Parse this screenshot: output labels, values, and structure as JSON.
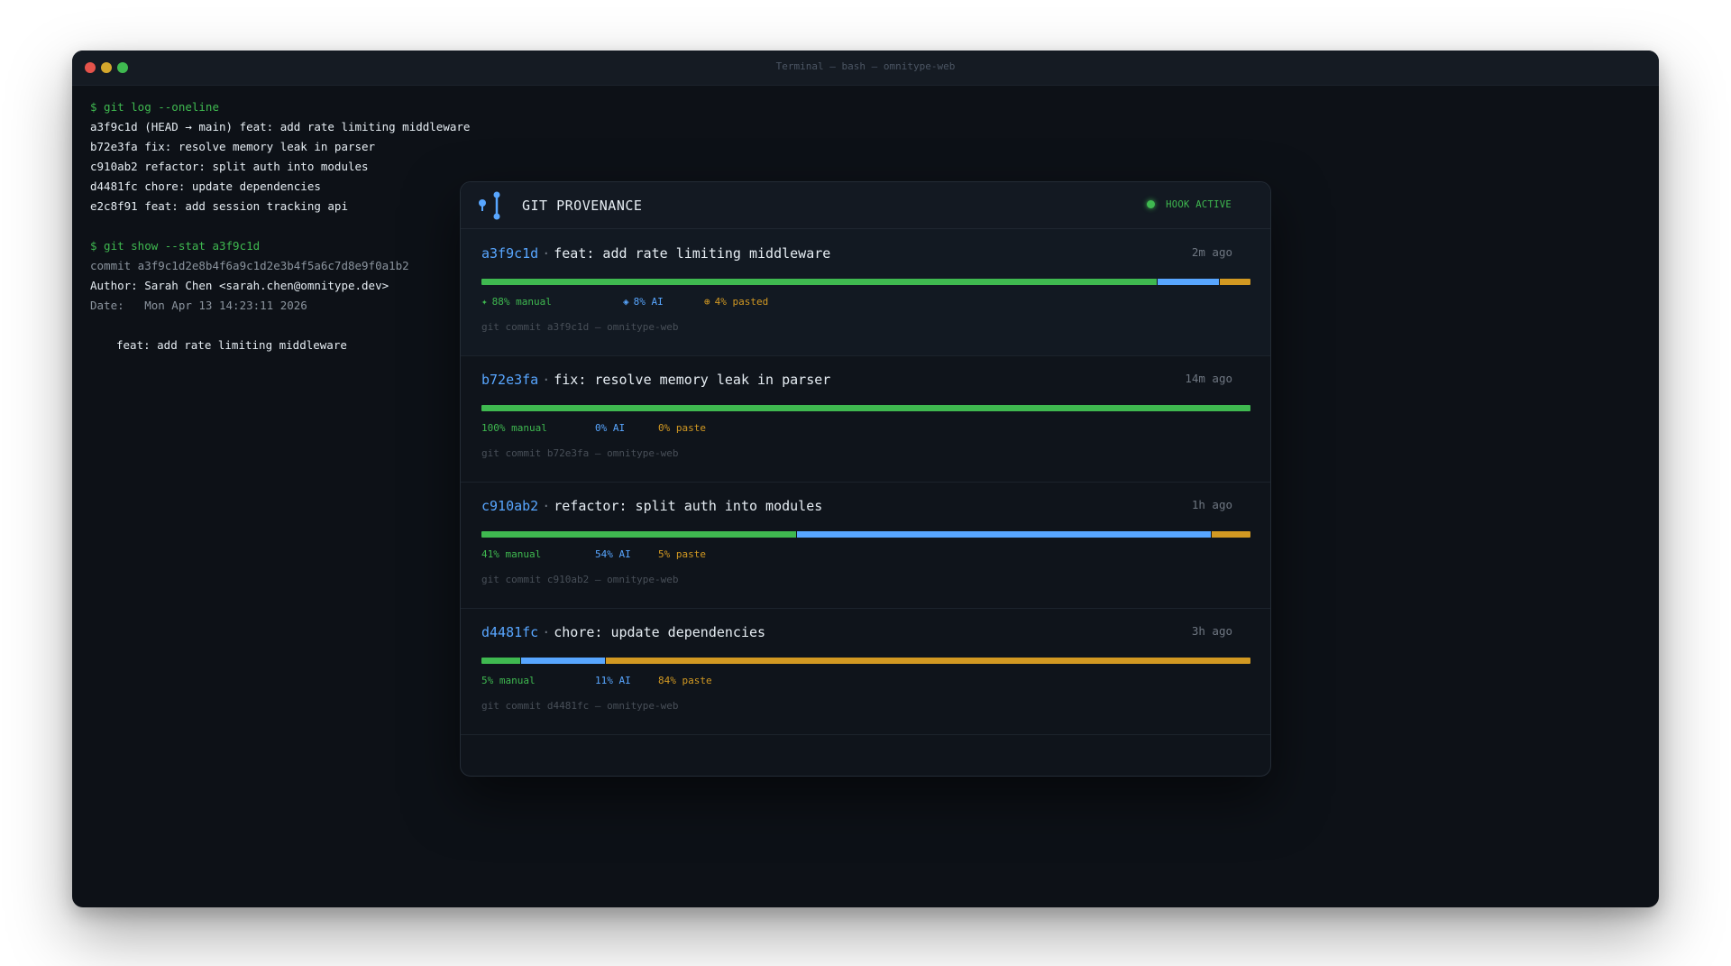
{
  "window": {
    "title": "Terminal — bash — omnitype-web"
  },
  "terminal": {
    "lines": [
      {
        "text": "$ git log --oneline",
        "style": "cmd"
      },
      {
        "text": "a3f9c1d (HEAD → main) feat: add rate limiting middleware",
        "style": "out"
      },
      {
        "text": "b72e3fa fix: resolve memory leak in parser",
        "style": "out"
      },
      {
        "text": "c910ab2 refactor: split auth into modules",
        "style": "out"
      },
      {
        "text": "d4481fc chore: update dependencies",
        "style": "out"
      },
      {
        "text": "e2c8f91 feat: add session tracking api",
        "style": "out"
      },
      {
        "text": "",
        "style": "out"
      },
      {
        "text": "$ git show --stat a3f9c1d",
        "style": "cmd"
      },
      {
        "text": "commit a3f9c1d2e8b4f6a9c1d2e3b4f5a6c7d8e9f0a1b2",
        "style": "dim"
      },
      {
        "text": "Author: Sarah Chen <sarah.chen@omnitype.dev>",
        "style": "out"
      },
      {
        "text": "Date:   Mon Apr 13 14:23:11 2026",
        "style": "dim"
      },
      {
        "text": "",
        "style": "out"
      },
      {
        "text": "feat: add rate limiting middleware",
        "style": "indent"
      }
    ]
  },
  "panel": {
    "title": "GIT PROVENANCE",
    "status": "HOOK ACTIVE",
    "icon": "git-branch-icon",
    "colors": {
      "manual": "#3fb950",
      "ai": "#58a6ff",
      "paste": "#d29922"
    },
    "commits": [
      {
        "hash": "a3f9c1d",
        "sep": "·",
        "message": "feat: add rate limiting middleware",
        "time": "2m ago",
        "manual": 88,
        "ai": 8,
        "paste": 4,
        "manual_label": "88% manual",
        "ai_label": "8% AI",
        "paste_label": "4% pasted",
        "show_icons": true,
        "footer": "git commit a3f9c1d — omnitype-web"
      },
      {
        "hash": "b72e3fa",
        "sep": "·",
        "message": "fix: resolve memory leak in parser",
        "time": "14m ago",
        "manual": 100,
        "ai": 0,
        "paste": 0,
        "manual_label": "100% manual",
        "ai_label": "0% AI",
        "paste_label": "0% paste",
        "show_icons": false,
        "footer": "git commit b72e3fa — omnitype-web"
      },
      {
        "hash": "c910ab2",
        "sep": "·",
        "message": "refactor: split auth into modules",
        "time": "1h ago",
        "manual": 41,
        "ai": 54,
        "paste": 5,
        "manual_label": "41% manual",
        "ai_label": "54% AI",
        "paste_label": "5% paste",
        "show_icons": false,
        "footer": "git commit c910ab2 — omnitype-web"
      },
      {
        "hash": "d4481fc",
        "sep": "·",
        "message": "chore: update dependencies",
        "time": "3h ago",
        "manual": 5,
        "ai": 11,
        "paste": 84,
        "manual_label": "5% manual",
        "ai_label": "11% AI",
        "paste_label": "84% paste",
        "show_icons": false,
        "footer": "git commit d4481fc — omnitype-web"
      }
    ]
  }
}
